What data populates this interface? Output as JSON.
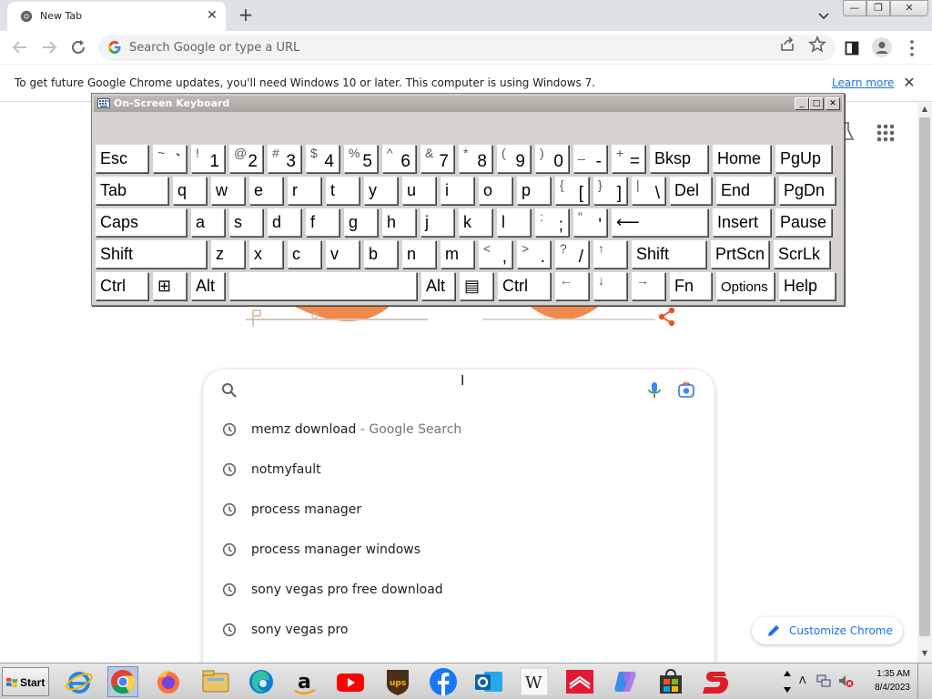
{
  "browser": {
    "tab_title": "New Tab",
    "tab_close": "✕",
    "new_tab": "+",
    "omnibox_placeholder": "Search Google or type a URL",
    "window_min": "—",
    "window_max": "❐",
    "window_close": "✕"
  },
  "infobar": {
    "message": "To get future Google Chrome updates, you'll need Windows 10 or later. This computer is using Windows 7.",
    "link": "Learn more",
    "close": "✕"
  },
  "newtab": {
    "search_placeholder": "",
    "suggestions": [
      {
        "text": "memz download",
        "suffix": " - Google Search"
      },
      {
        "text": "notmyfault",
        "suffix": ""
      },
      {
        "text": "process manager",
        "suffix": ""
      },
      {
        "text": "process manager windows",
        "suffix": ""
      },
      {
        "text": "sony vegas pro free download",
        "suffix": ""
      },
      {
        "text": "sony vegas pro",
        "suffix": ""
      }
    ],
    "customize_label": "Customize Chrome"
  },
  "osk": {
    "title": "On-Screen Keyboard",
    "min": "_",
    "max": "□",
    "close": "✕",
    "rows": [
      [
        {
          "label": "Esc"
        },
        {
          "up": "~",
          "dn": "`"
        },
        {
          "up": "!",
          "dn": "1"
        },
        {
          "up": "@",
          "dn": "2"
        },
        {
          "up": "#",
          "dn": "3"
        },
        {
          "up": "$",
          "dn": "4"
        },
        {
          "up": "%",
          "dn": "5"
        },
        {
          "up": "^",
          "dn": "6"
        },
        {
          "up": "&",
          "dn": "7"
        },
        {
          "up": "*",
          "dn": "8"
        },
        {
          "up": "(",
          "dn": "9"
        },
        {
          "up": ")",
          "dn": "0"
        },
        {
          "up": "_",
          "dn": "-"
        },
        {
          "up": "+",
          "dn": "="
        },
        {
          "label": "Bksp"
        },
        {
          "label": "Home"
        },
        {
          "label": "PgUp"
        }
      ],
      [
        {
          "label": "Tab"
        },
        {
          "label": "q"
        },
        {
          "label": "w"
        },
        {
          "label": "e"
        },
        {
          "label": "r"
        },
        {
          "label": "t"
        },
        {
          "label": "y"
        },
        {
          "label": "u"
        },
        {
          "label": "i"
        },
        {
          "label": "o"
        },
        {
          "label": "p"
        },
        {
          "up": "{",
          "dn": "["
        },
        {
          "up": "}",
          "dn": "]"
        },
        {
          "up": "|",
          "dn": "\\"
        },
        {
          "label": "Del"
        },
        {
          "label": "End"
        },
        {
          "label": "PgDn"
        }
      ],
      [
        {
          "label": "Caps"
        },
        {
          "label": "a"
        },
        {
          "label": "s"
        },
        {
          "label": "d"
        },
        {
          "label": "f"
        },
        {
          "label": "g"
        },
        {
          "label": "h"
        },
        {
          "label": "j"
        },
        {
          "label": "k"
        },
        {
          "label": "l"
        },
        {
          "up": ":",
          "dn": ";"
        },
        {
          "up": "\"",
          "dn": "'"
        },
        {
          "label": "⟵"
        },
        {
          "label": "Insert"
        },
        {
          "label": "Pause"
        }
      ],
      [
        {
          "label": "Shift"
        },
        {
          "label": "z"
        },
        {
          "label": "x"
        },
        {
          "label": "c"
        },
        {
          "label": "v"
        },
        {
          "label": "b"
        },
        {
          "label": "n"
        },
        {
          "label": "m"
        },
        {
          "up": "<",
          "dn": ","
        },
        {
          "up": ">",
          "dn": "."
        },
        {
          "up": "?",
          "dn": "/"
        },
        {
          "up": "↑",
          "dn": ""
        },
        {
          "label": "Shift"
        },
        {
          "label": "PrtScn"
        },
        {
          "label": "ScrLk"
        }
      ],
      [
        {
          "label": "Ctrl"
        },
        {
          "label": "⊞"
        },
        {
          "label": "Alt"
        },
        {
          "label": ""
        },
        {
          "label": "Alt"
        },
        {
          "label": "▤"
        },
        {
          "label": "Ctrl"
        },
        {
          "up": "←",
          "dn": ""
        },
        {
          "up": "↓",
          "dn": ""
        },
        {
          "up": "→",
          "dn": ""
        },
        {
          "label": "Fn"
        },
        {
          "label": "Options"
        },
        {
          "label": "Help"
        }
      ]
    ]
  },
  "taskbar": {
    "start_label": "Start",
    "apps": [
      "internet-explorer",
      "chrome",
      "firefox",
      "file-explorer",
      "edge",
      "amazon",
      "youtube",
      "ups",
      "facebook",
      "outlook",
      "wikipedia",
      "bank-of-america",
      "copilot",
      "store",
      "game"
    ],
    "clock_time": "1:35 AM",
    "clock_date": "8/4/2023"
  },
  "colors": {
    "chrome_frame": "#dee1e6",
    "accent_blue": "#1a73e8",
    "osk_face": "#d6d3ce",
    "taskbar": "#d9d9d9"
  }
}
